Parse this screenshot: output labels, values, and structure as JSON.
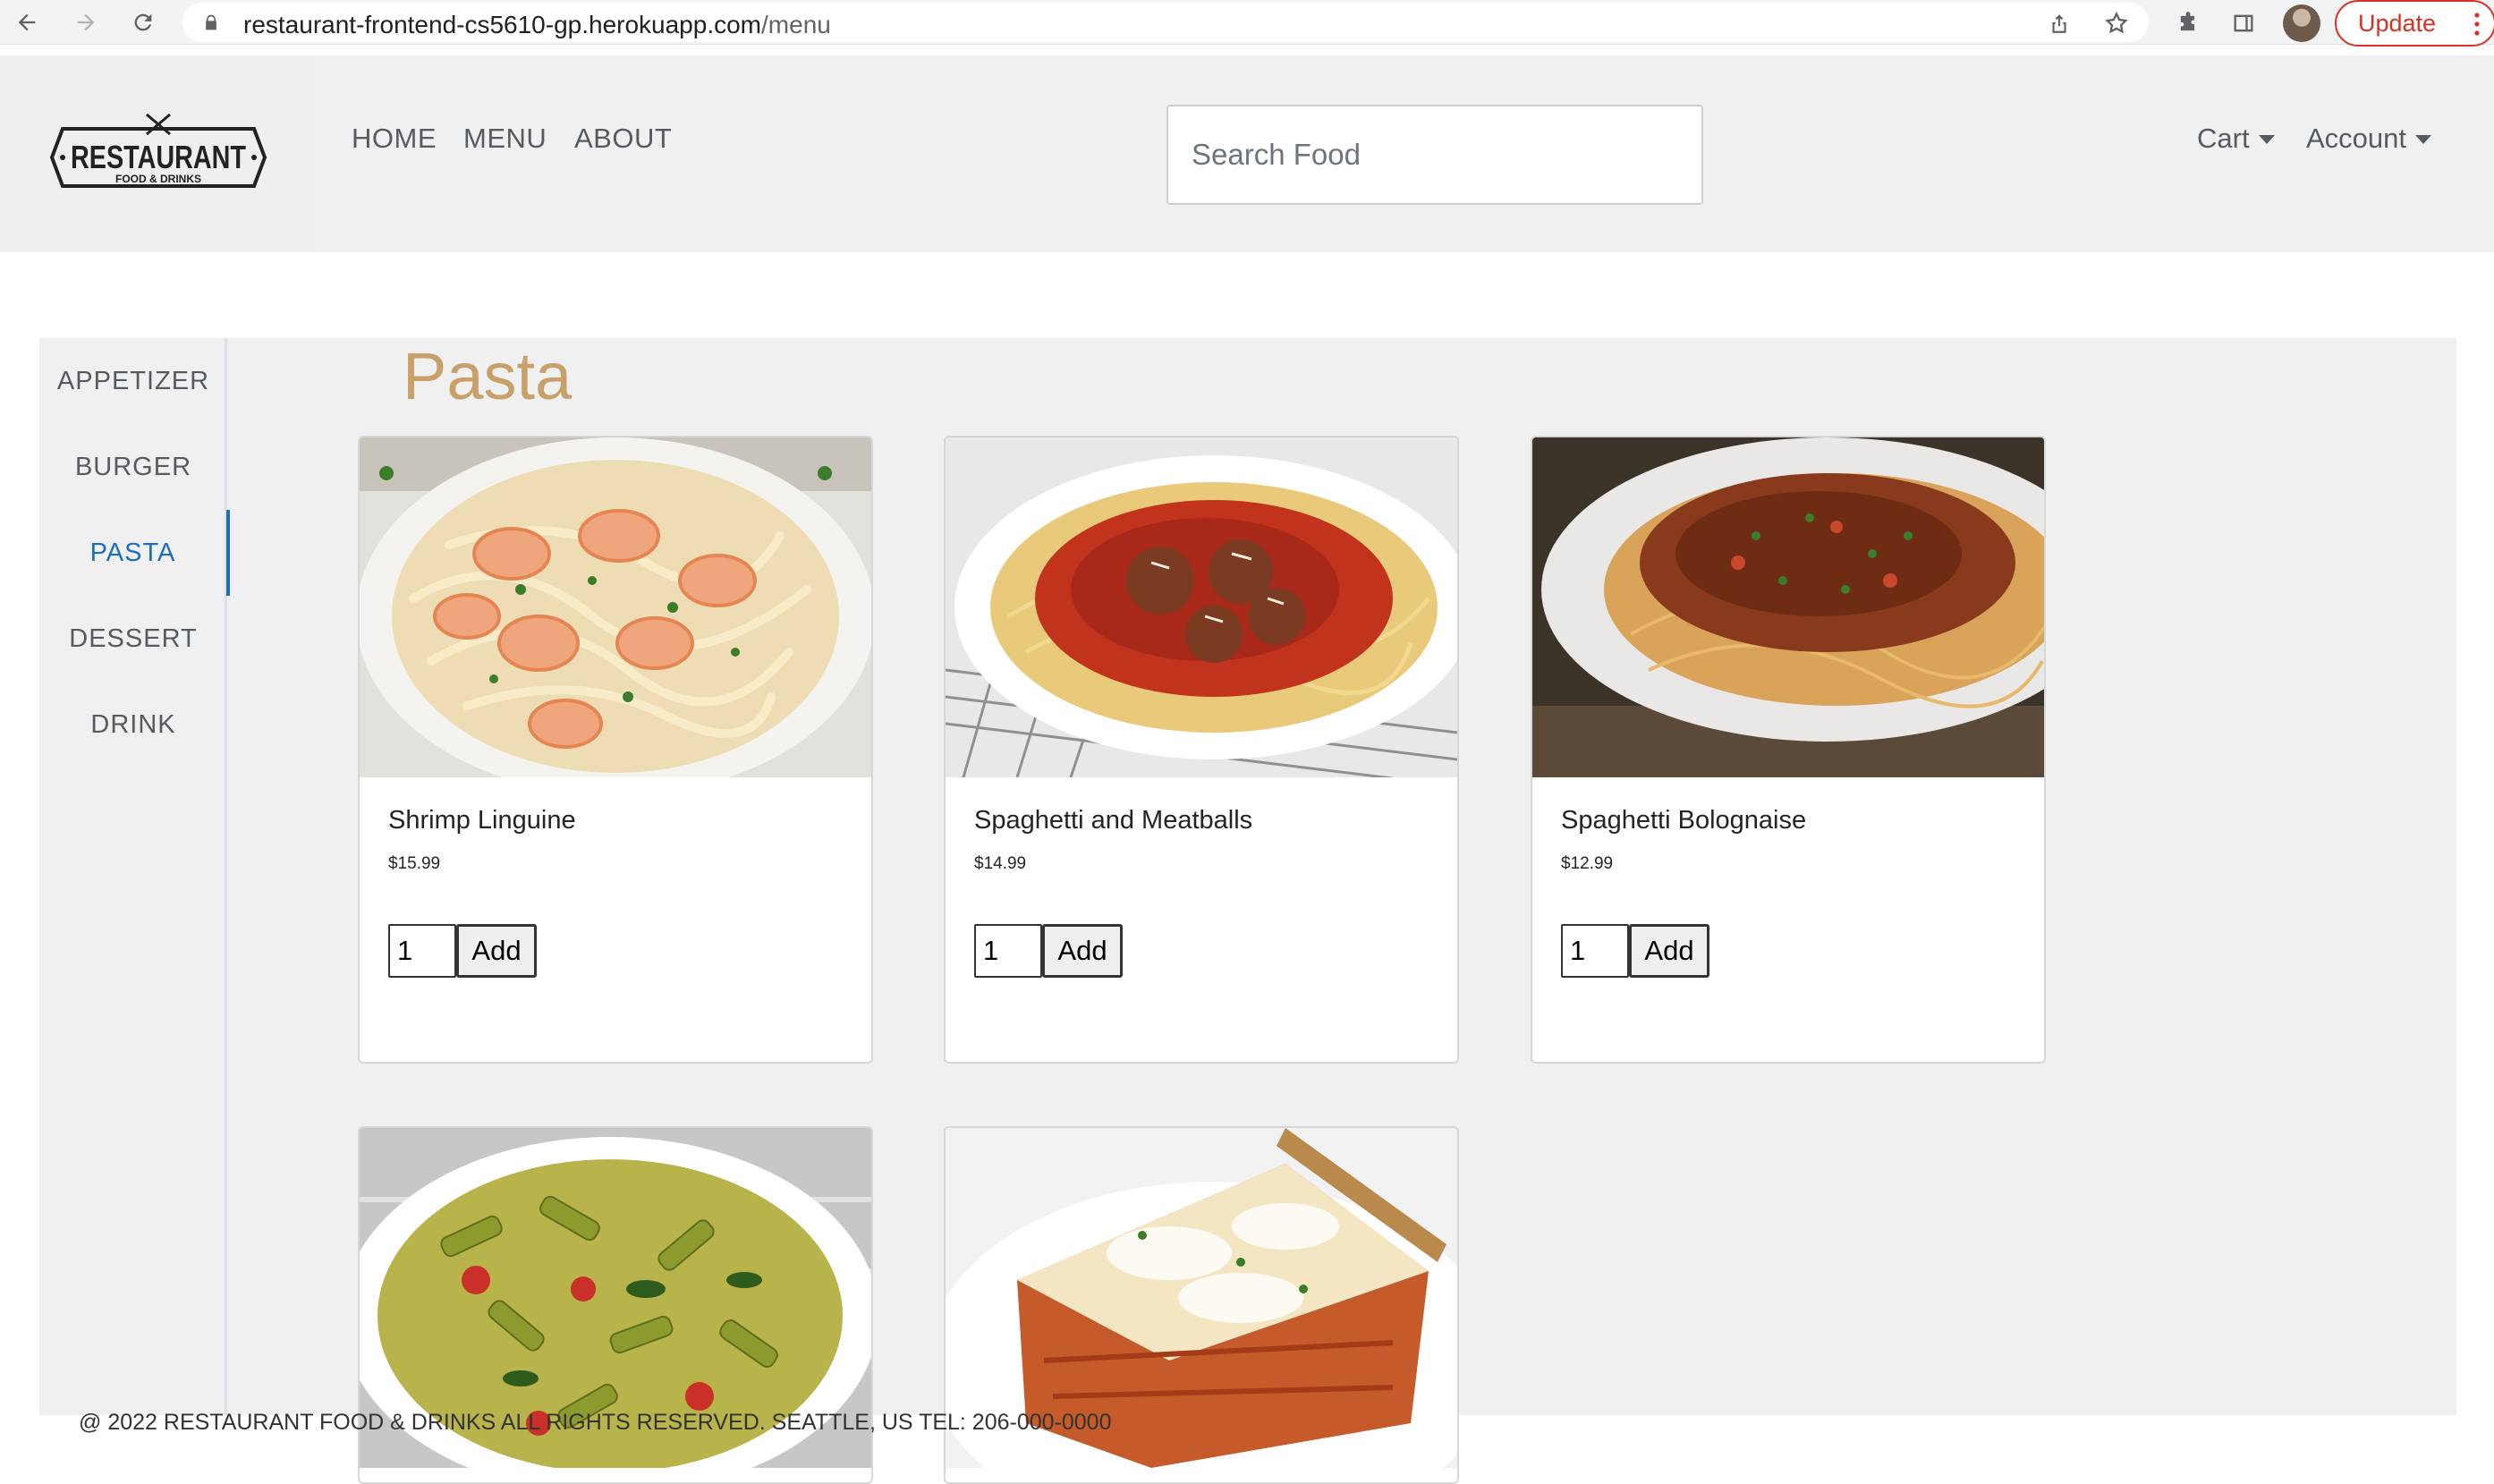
{
  "browser": {
    "url_host": "restaurant-frontend-cs5610-gp.herokuapp.com",
    "url_path": "/menu",
    "update_label": "Update"
  },
  "header": {
    "logo_text": "RESTAURANT",
    "logo_subtext": "FOOD & DRINKS",
    "nav": [
      "HOME",
      "MENU",
      "ABOUT"
    ],
    "search_placeholder": "Search Food",
    "cart_label": "Cart",
    "account_label": "Account"
  },
  "sidebar": {
    "categories": [
      "APPETIZER",
      "BURGER",
      "PASTA",
      "DESSERT",
      "DRINK"
    ],
    "active": "PASTA"
  },
  "menu": {
    "section_title": "Pasta",
    "items": [
      {
        "name": "Shrimp Linguine",
        "price": "$15.99",
        "qty": "1",
        "add_label": "Add",
        "image": "shrimp-linguine"
      },
      {
        "name": "Spaghetti and Meatballs",
        "price": "$14.99",
        "qty": "1",
        "add_label": "Add",
        "image": "spaghetti-meatballs"
      },
      {
        "name": "Spaghetti Bolognaise",
        "price": "$12.99",
        "qty": "1",
        "add_label": "Add",
        "image": "spaghetti-bolognaise"
      },
      {
        "image": "pesto-penne"
      },
      {
        "image": "lasagna"
      }
    ]
  },
  "footer": {
    "text": "@ 2022 RESTAURANT FOOD & DRINKS ALL RIGHTS RESERVED. SEATTLE, US TEL: 206-000-0000"
  },
  "colors": {
    "accent": "#1b6ec2",
    "title": "#c8a06a",
    "update": "#d93025"
  }
}
